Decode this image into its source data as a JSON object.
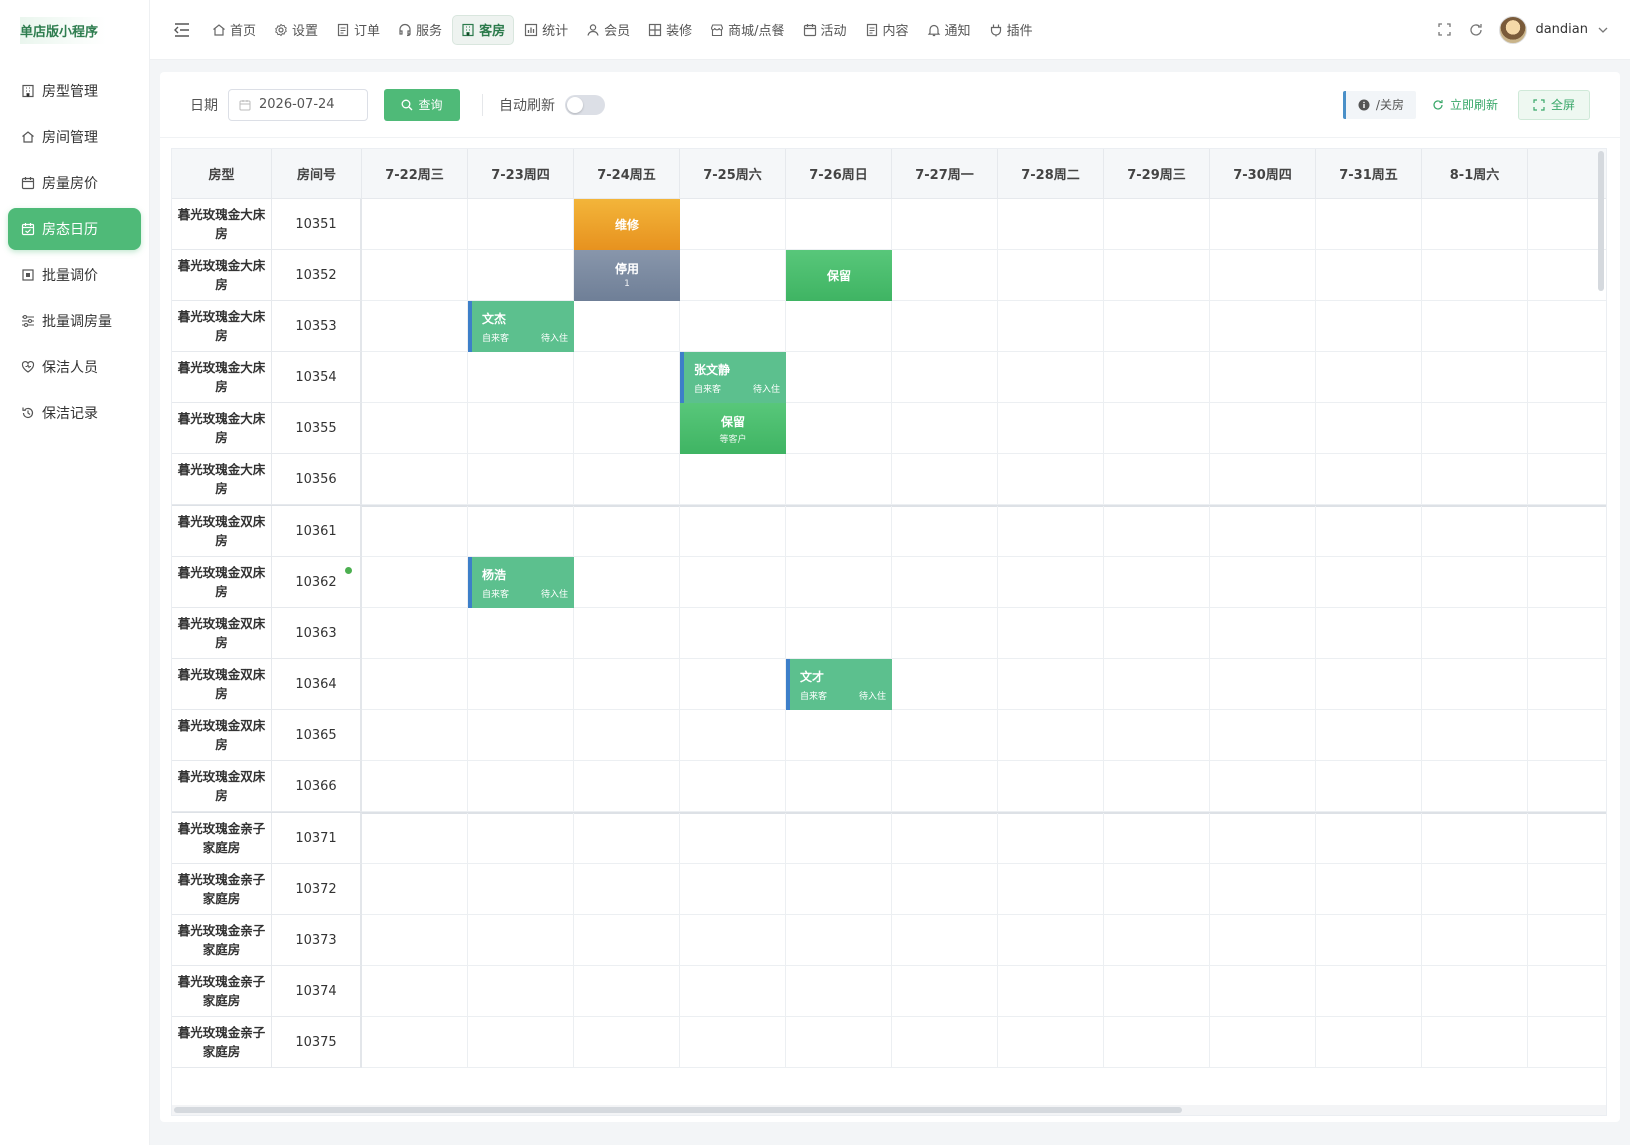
{
  "brand": {
    "title": "单店版小程序"
  },
  "sidebar": {
    "items": [
      {
        "label": "房型管理",
        "icon": "building-icon",
        "active": false
      },
      {
        "label": "房间管理",
        "icon": "home-icon",
        "active": false
      },
      {
        "label": "房量房价",
        "icon": "calendar-icon",
        "active": false
      },
      {
        "label": "房态日历",
        "icon": "calendar-check-icon",
        "active": true
      },
      {
        "label": "批量调价",
        "icon": "price-tag-icon",
        "active": false
      },
      {
        "label": "批量调房量",
        "icon": "sliders-icon",
        "active": false
      },
      {
        "label": "保洁人员",
        "icon": "heart-icon",
        "active": false
      },
      {
        "label": "保洁记录",
        "icon": "history-icon",
        "active": false
      }
    ]
  },
  "topnav": {
    "items": [
      {
        "label": "首页",
        "icon": "home-icon",
        "active": false
      },
      {
        "label": "设置",
        "icon": "gear-icon",
        "active": false
      },
      {
        "label": "订单",
        "icon": "document-icon",
        "active": false
      },
      {
        "label": "服务",
        "icon": "headset-icon",
        "active": false
      },
      {
        "label": "客房",
        "icon": "building-icon",
        "active": true
      },
      {
        "label": "统计",
        "icon": "bar-chart-icon",
        "active": false
      },
      {
        "label": "会员",
        "icon": "user-icon",
        "active": false
      },
      {
        "label": "装修",
        "icon": "layout-icon",
        "active": false
      },
      {
        "label": "商城/点餐",
        "icon": "shop-icon",
        "active": false
      },
      {
        "label": "活动",
        "icon": "calendar-icon",
        "active": false
      },
      {
        "label": "内容",
        "icon": "document-icon",
        "active": false
      },
      {
        "label": "通知",
        "icon": "bell-icon",
        "active": false
      },
      {
        "label": "插件",
        "icon": "plugin-icon",
        "active": false
      }
    ],
    "username": "dandian"
  },
  "toolbar": {
    "date_label": "日期",
    "date_value": "2026-07-24",
    "query_label": "查询",
    "auto_refresh_label": "自动刷新",
    "auto_refresh_on": false,
    "room_toggle_label": "/关房",
    "refresh_now_label": "立即刷新",
    "fullscreen_label": "全屏"
  },
  "calendar": {
    "col_type": "房型",
    "col_room": "房间号",
    "dates": [
      "7-22周三",
      "7-23周四",
      "7-24周五",
      "7-25周六",
      "7-26周日",
      "7-27周一",
      "7-28周二",
      "7-29周三",
      "7-30周四",
      "7-31周五",
      "8-1周六"
    ],
    "rooms": [
      {
        "type": "暮光玫瑰金大床房",
        "number": "10351",
        "group_start": false,
        "dot": false
      },
      {
        "type": "暮光玫瑰金大床房",
        "number": "10352",
        "group_start": false,
        "dot": false
      },
      {
        "type": "暮光玫瑰金大床房",
        "number": "10353",
        "group_start": false,
        "dot": false
      },
      {
        "type": "暮光玫瑰金大床房",
        "number": "10354",
        "group_start": false,
        "dot": false
      },
      {
        "type": "暮光玫瑰金大床房",
        "number": "10355",
        "group_start": false,
        "dot": false
      },
      {
        "type": "暮光玫瑰金大床房",
        "number": "10356",
        "group_start": false,
        "dot": false
      },
      {
        "type": "暮光玫瑰金双床房",
        "number": "10361",
        "group_start": true,
        "dot": false
      },
      {
        "type": "暮光玫瑰金双床房",
        "number": "10362",
        "group_start": false,
        "dot": true
      },
      {
        "type": "暮光玫瑰金双床房",
        "number": "10363",
        "group_start": false,
        "dot": false
      },
      {
        "type": "暮光玫瑰金双床房",
        "number": "10364",
        "group_start": false,
        "dot": false
      },
      {
        "type": "暮光玫瑰金双床房",
        "number": "10365",
        "group_start": false,
        "dot": false
      },
      {
        "type": "暮光玫瑰金双床房",
        "number": "10366",
        "group_start": false,
        "dot": false
      },
      {
        "type": "暮光玫瑰金亲子家庭房",
        "number": "10371",
        "group_start": true,
        "dot": false
      },
      {
        "type": "暮光玫瑰金亲子家庭房",
        "number": "10372",
        "group_start": false,
        "dot": false
      },
      {
        "type": "暮光玫瑰金亲子家庭房",
        "number": "10373",
        "group_start": false,
        "dot": false
      },
      {
        "type": "暮光玫瑰金亲子家庭房",
        "number": "10374",
        "group_start": false,
        "dot": false
      },
      {
        "type": "暮光玫瑰金亲子家庭房",
        "number": "10375",
        "group_start": false,
        "dot": false
      }
    ],
    "status_colors": {
      "maintenance": "#f0a72a",
      "disabled": "#7d8ca3",
      "reserved": "#4cc26f",
      "guest": "#5cc08e",
      "guest_accent": "#3d7fc9"
    },
    "blocks": [
      {
        "row": 0,
        "col": 2,
        "kind": "maintenance",
        "title": "维修"
      },
      {
        "row": 1,
        "col": 2,
        "kind": "disabled",
        "title": "停用",
        "sub": "1"
      },
      {
        "row": 1,
        "col": 4,
        "kind": "reserved",
        "title": "保留"
      },
      {
        "row": 2,
        "col": 1,
        "kind": "guest",
        "title": "文杰",
        "source": "自来客",
        "status": "待入住"
      },
      {
        "row": 3,
        "col": 3,
        "kind": "guest",
        "title": "张文静",
        "source": "自来客",
        "status": "待入住"
      },
      {
        "row": 4,
        "col": 3,
        "kind": "reserved",
        "title": "保留",
        "sub": "等客户"
      },
      {
        "row": 7,
        "col": 1,
        "kind": "guest",
        "title": "杨浩",
        "source": "自来客",
        "status": "待入住"
      },
      {
        "row": 9,
        "col": 4,
        "kind": "guest",
        "title": "文才",
        "source": "自来客",
        "status": "待入住"
      }
    ]
  }
}
